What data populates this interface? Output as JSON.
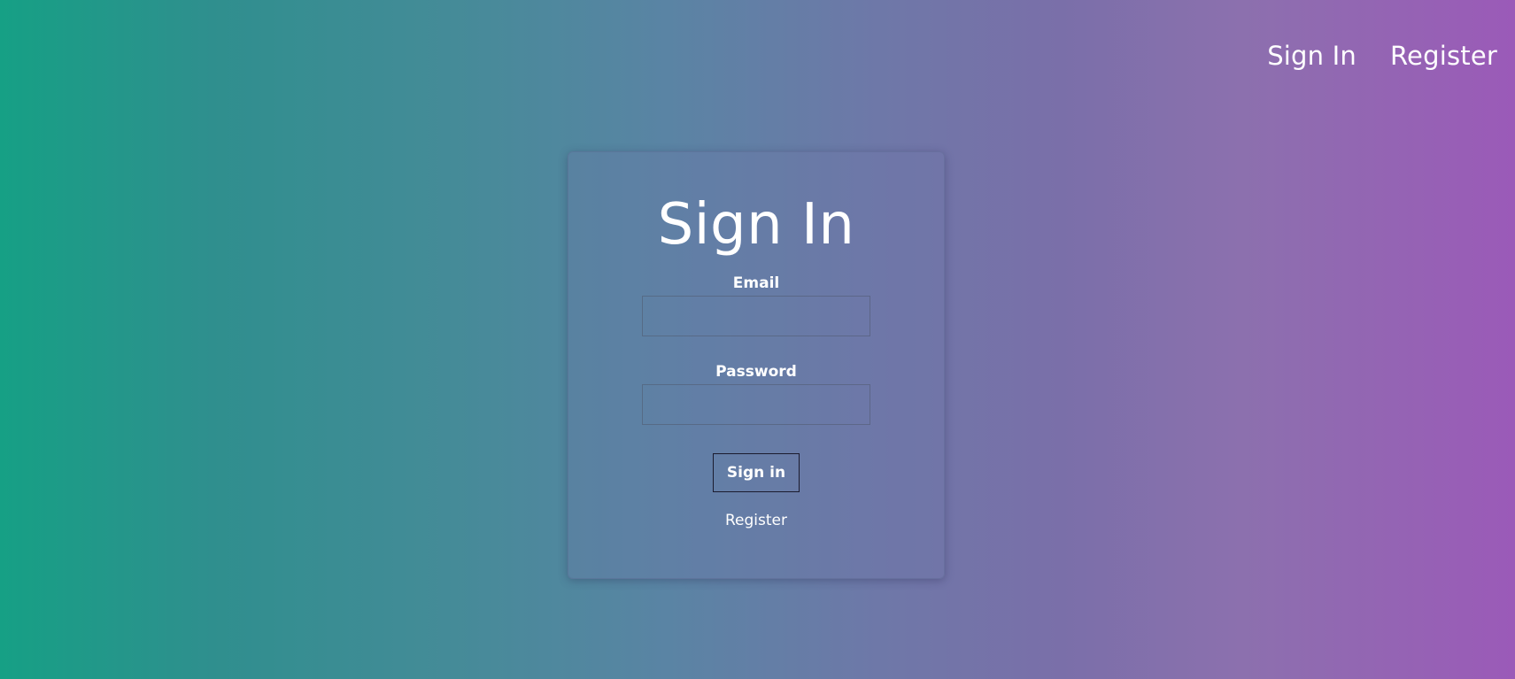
{
  "nav": {
    "sign_in": "Sign In",
    "register": "Register"
  },
  "card": {
    "title": "Sign In",
    "email_label": "Email",
    "email_value": "",
    "password_label": "Password",
    "password_value": "",
    "submit_label": "Sign in",
    "register_link": "Register"
  },
  "colors": {
    "gradient_start": "#16a085",
    "gradient_end": "#9b5ab8",
    "text": "#ffffff"
  }
}
